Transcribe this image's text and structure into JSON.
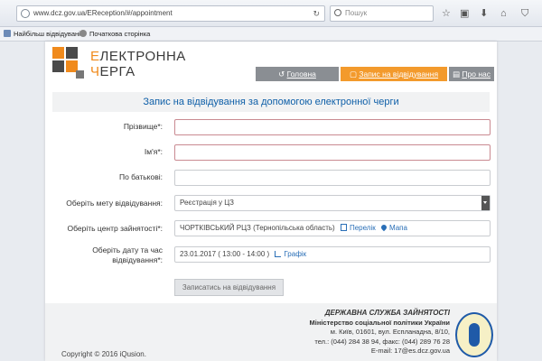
{
  "browser": {
    "url": "www.dcz.gov.ua/EReception/#/appointment",
    "search_placeholder": "Пошук",
    "bookmarks": [
      {
        "label": "Найбільш відвідувані"
      },
      {
        "label": "Початкова сторінка"
      }
    ]
  },
  "header": {
    "logo_first_letter_1": "Е",
    "logo_rest_1": "ЛЕКТРОННА",
    "logo_first_letter_2": "Ч",
    "logo_rest_2": "ЕРГА",
    "nav": [
      {
        "label": "Головна"
      },
      {
        "label": "Запис на відвідування"
      },
      {
        "label": "Про нас"
      }
    ]
  },
  "form": {
    "title": "Запис на відвідування за допомогою електронної черги",
    "surname_label": "Прізвище*:",
    "name_label": "Ім'я*:",
    "patronymic_label": "По батькові:",
    "purpose_label": "Оберіть мету відвідування:",
    "purpose_value": "Реєстрація у ЦЗ",
    "center_label": "Оберіть центр зайнятості*:",
    "center_value": "ЧОРТКІВСЬКИЙ РЦЗ (Тернопільська область)",
    "center_list_link": "Перелік",
    "center_map_link": "Мапа",
    "datetime_label_1": "Оберіть дату та час",
    "datetime_label_2": "відвідування*:",
    "datetime_value": "23.01.2017 ( 13:00 - 14:00 )",
    "schedule_link": "Графік",
    "submit_label": "Записатись на відвідування"
  },
  "footer": {
    "copyright": "Copyright © 2016 iQusion.",
    "org_title": "ДЕРЖАВНА СЛУЖБА ЗАЙНЯТОСТІ",
    "ministry": "Міністерство соціальної політики України",
    "address": "м. Київ, 01601, вул. Еспланадна, 8/10,",
    "phone": "тел.: (044) 284 38 94, факс: (044) 289 76 28",
    "email": "E-mail: 17@es.dcz.gov.ua"
  },
  "colors": {
    "accent": "#f39a2c",
    "link": "#0e5fa8",
    "nav_gray": "#8a8e93"
  }
}
